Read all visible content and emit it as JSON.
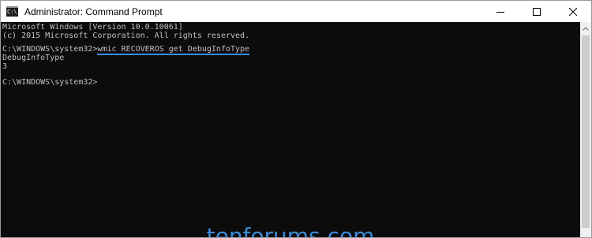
{
  "window": {
    "title": "Administrator: Command Prompt",
    "icon_text": "C:\\"
  },
  "console": {
    "lines": [
      "Microsoft Windows [Version 10.0.10061]",
      "(c) 2015 Microsoft Corporation. All rights reserved.",
      "",
      "C:\\WINDOWS\\system32>",
      "DebugInfoType",
      "3",
      "",
      "C:\\WINDOWS\\system32>"
    ],
    "command": "wmic RECOVEROS get DebugInfoType"
  },
  "watermark": "tenforums.com",
  "colors": {
    "console_bg": "#0c0c0c",
    "console_text": "#c0c0c0",
    "highlight": "#3a8fd6",
    "watermark": "#3b8ad9"
  },
  "icons": [
    "cmd-app-icon",
    "minimize-icon",
    "maximize-icon",
    "close-icon",
    "scroll-up-arrow-icon"
  ]
}
